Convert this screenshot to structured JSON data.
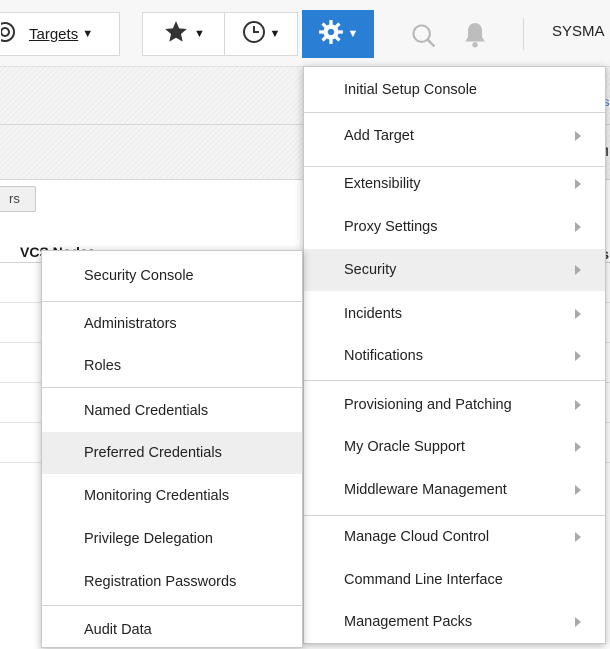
{
  "toolbar": {
    "targets_label": "Targets",
    "favorites_icon": "star-icon",
    "history_icon": "clock-icon",
    "setup_icon": "gear-icon",
    "search_icon": "search-icon",
    "notifications_icon": "bell-icon",
    "user": "SYSMA",
    "accent_color": "#2a7fd4"
  },
  "background": {
    "fragment_vcs": "/vcs",
    "fragment_am": "AM",
    "tab_fragment": "rs",
    "column_vcs": "VCS Nodes",
    "fragment_tus": "tus"
  },
  "setup_menu": {
    "items": [
      {
        "label": "Initial Setup Console",
        "submenu": false
      },
      {
        "label": "Add Target",
        "submenu": true
      },
      {
        "label": "Extensibility",
        "submenu": true
      },
      {
        "label": "Proxy Settings",
        "submenu": true
      },
      {
        "label": "Security",
        "submenu": true,
        "highlighted": true
      },
      {
        "label": "Incidents",
        "submenu": true
      },
      {
        "label": "Notifications",
        "submenu": true
      },
      {
        "label": "Provisioning and Patching",
        "submenu": true
      },
      {
        "label": "My Oracle Support",
        "submenu": true
      },
      {
        "label": "Middleware Management",
        "submenu": true
      },
      {
        "label": "Manage Cloud Control",
        "submenu": true
      },
      {
        "label": "Command Line Interface",
        "submenu": false
      },
      {
        "label": "Management Packs",
        "submenu": true
      }
    ]
  },
  "security_submenu": {
    "items": [
      {
        "label": "Security Console"
      },
      {
        "label": "Administrators"
      },
      {
        "label": "Roles"
      },
      {
        "label": "Named Credentials"
      },
      {
        "label": "Preferred Credentials",
        "highlighted": true
      },
      {
        "label": "Monitoring Credentials"
      },
      {
        "label": "Privilege Delegation"
      },
      {
        "label": "Registration Passwords"
      },
      {
        "label": "Audit Data"
      }
    ]
  }
}
